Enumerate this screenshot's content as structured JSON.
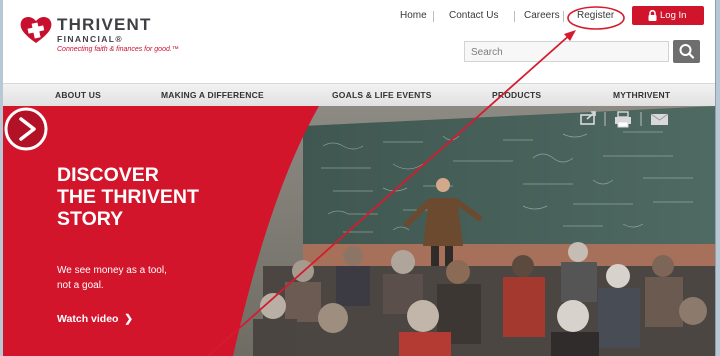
{
  "brand": {
    "name": "THRIVENT",
    "sub": "FINANCIAL®",
    "tagline": "Connecting faith & finances for good.™",
    "color": "#c8102e"
  },
  "top_nav": {
    "home": "Home",
    "contact": "Contact Us",
    "careers": "Careers",
    "register": "Register",
    "login": "Log In"
  },
  "search": {
    "placeholder": "Search"
  },
  "main_nav": [
    "ABOUT US",
    "MAKING A DIFFERENCE",
    "GOALS & LIFE EVENTS",
    "PRODUCTS",
    "MYTHRIVENT"
  ],
  "hero": {
    "title_lines": [
      "DISCOVER",
      "THE THRIVENT",
      "STORY"
    ],
    "body_lines": [
      "We see money as a tool,",
      "not a goal."
    ],
    "cta": "Watch video",
    "cta_icon": "chevron-right-icon"
  },
  "icons": {
    "logo": "heart-cross-logo-icon",
    "login": "lock-icon",
    "search": "search-icon",
    "play": "play-icon",
    "share": "share-icon",
    "print": "print-icon",
    "email": "email-icon"
  },
  "annotation": {
    "color": "#d41c2e"
  }
}
